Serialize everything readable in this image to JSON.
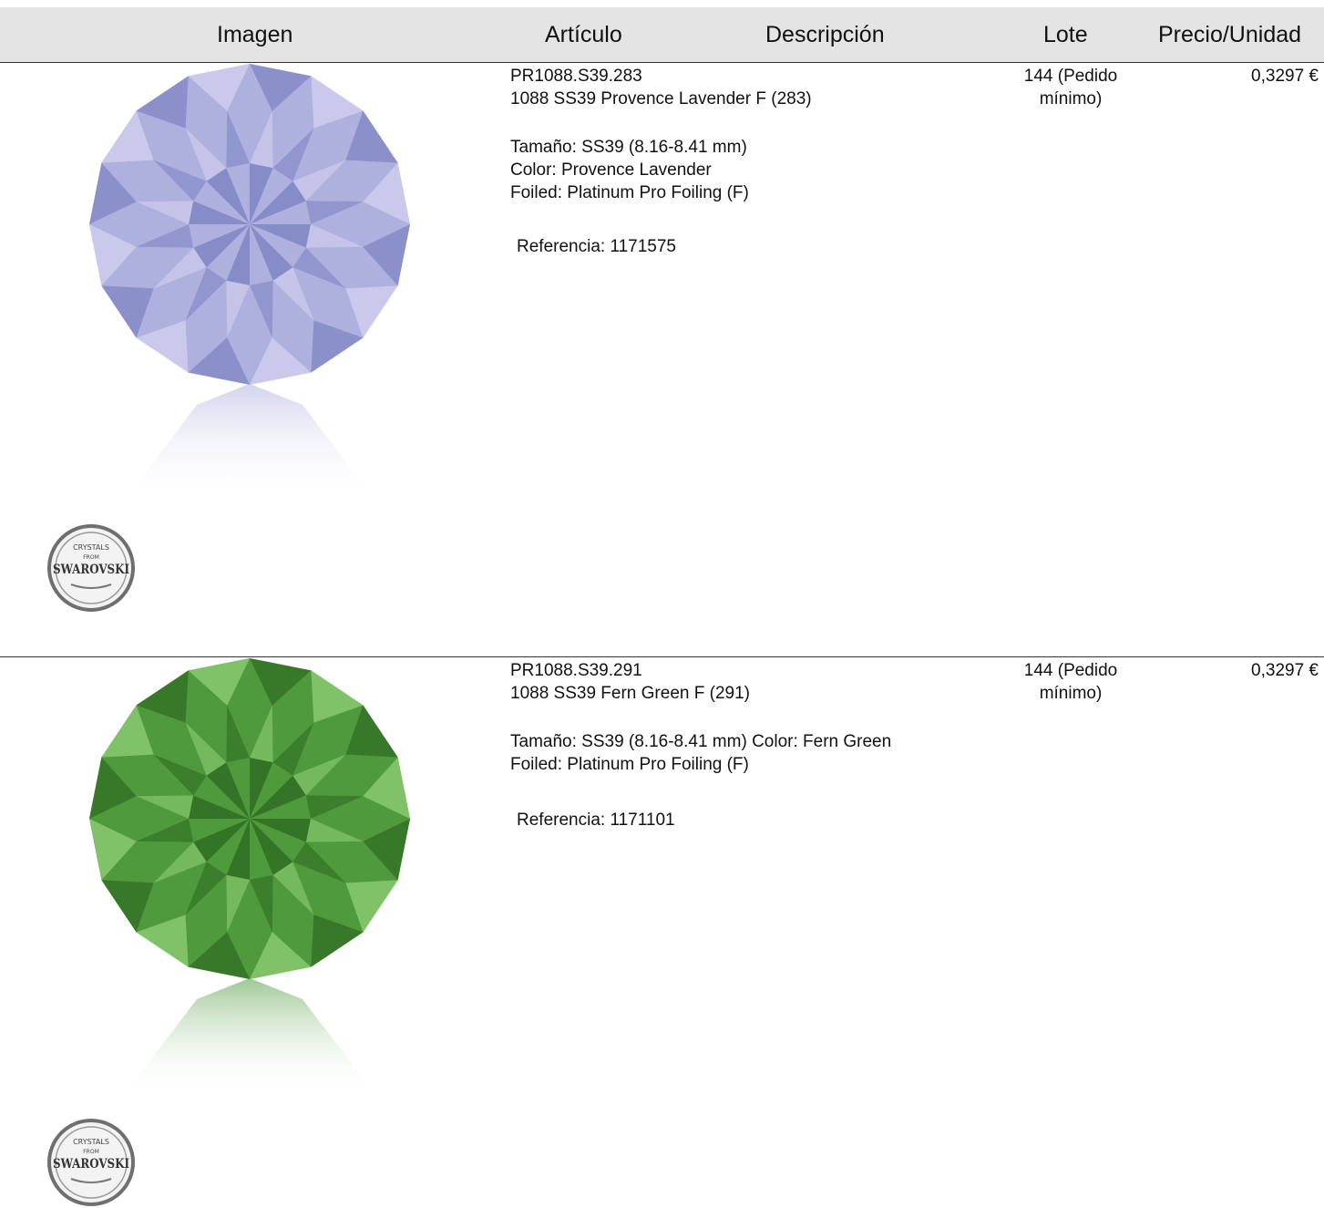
{
  "header": {
    "imagen": "Imagen",
    "articulo": "Artículo",
    "descripcion": "Descripción",
    "lote": "Lote",
    "precio": "Precio/Unidad"
  },
  "products": [
    {
      "code": "PR1088.S39.283",
      "name": "1088 SS39 Provence Lavender F (283)",
      "spec_lines": [
        "Tamaño: SS39 (8.16-8.41 mm)",
        "Color: Provence Lavender",
        "Foiled: Platinum Pro Foiling (F)"
      ],
      "reference": "Referencia: 1171575",
      "lote_line1": "144 (Pedido",
      "lote_line2": "mínimo)",
      "price": "0,3297 €",
      "gem_color_main": "#aeb0de",
      "gem_color_dark": "#7f86c4",
      "gem_color_light": "#d3d2ef",
      "logo_text": "SWAROVSKI",
      "logo_top": "CRYSTALS",
      "logo_mid": "FROM"
    },
    {
      "code": "PR1088.S39.291",
      "name": "1088 SS39 Fern Green F (291)",
      "spec_lines": [
        "Tamaño: SS39 (8.16-8.41 mm) Color: Fern Green",
        "Foiled: Platinum Pro Foiling (F)"
      ],
      "reference": "Referencia: 1171101",
      "lote_line1": "144 (Pedido",
      "lote_line2": "mínimo)",
      "price": "0,3297 €",
      "gem_color_main": "#4f9a3c",
      "gem_color_dark": "#2f6d22",
      "gem_color_light": "#8fcf75",
      "logo_text": "SWAROVSKI",
      "logo_top": "CRYSTALS",
      "logo_mid": "FROM"
    }
  ]
}
